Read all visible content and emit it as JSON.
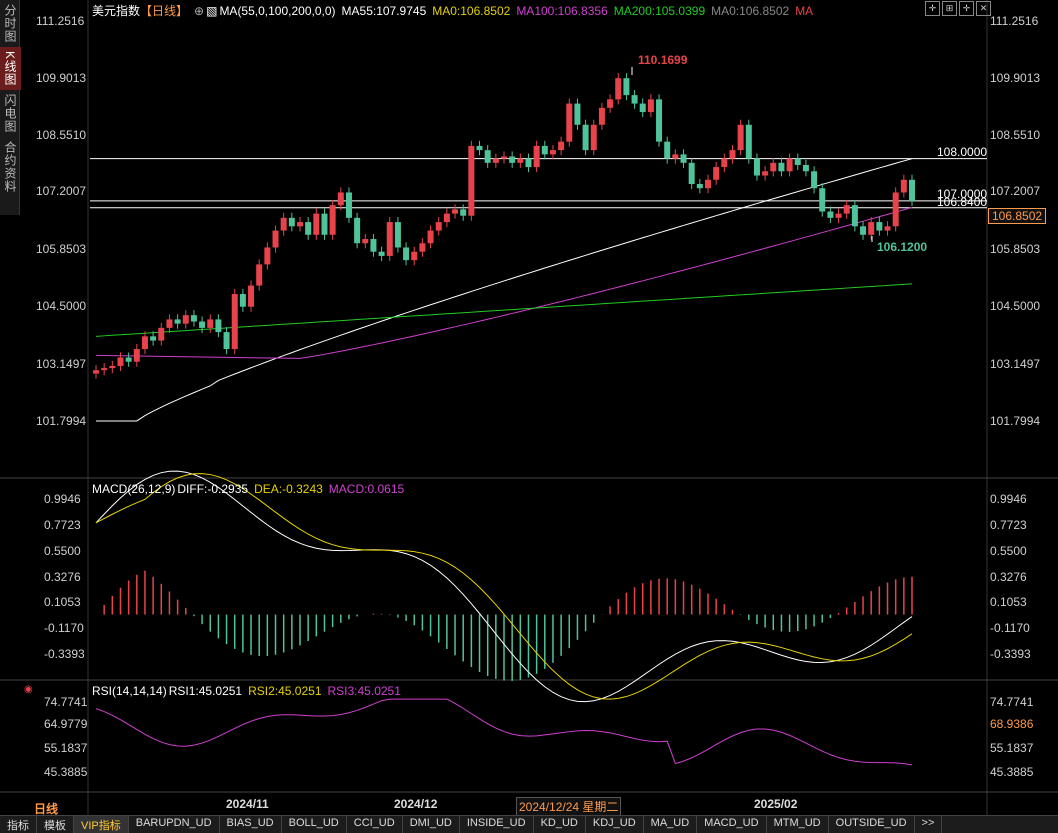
{
  "side_tabs": [
    "分时图",
    "K线图",
    "闪电图",
    "合约资料"
  ],
  "main_legend": {
    "title": "美元指数",
    "period": "【日线】",
    "plus": "⊕",
    "ma_params": "MA(55,0,100,200,0,0)",
    "ma55": "MA55:107.9745",
    "ma0a": "MA0:106.8502",
    "ma100": "MA100:106.8356",
    "ma200": "MA200:105.0399",
    "ma0b": "MA0:106.8502",
    "ma": "MA"
  },
  "price_axis_left": [
    "111.2516",
    "109.9013",
    "108.5510",
    "107.2007",
    "105.8503",
    "104.5000",
    "103.1497",
    "101.7994"
  ],
  "price_axis_right": [
    "111.2516",
    "109.9013",
    "108.5510",
    "107.2007",
    "105.8503",
    "104.5000",
    "103.1497",
    "101.7994"
  ],
  "current_price": "106.8502",
  "hlines": [
    {
      "label": "108.0000",
      "value": 108.0
    },
    {
      "label": "107.0000",
      "value": 107.0
    },
    {
      "label": "106.8400",
      "value": 106.84
    }
  ],
  "annotations": {
    "high": "110.1699",
    "low": "106.1200"
  },
  "macd_legend": {
    "params": "MACD(26,12,9)",
    "diff": "DIFF:-0.2935",
    "dea": "DEA:-0.3243",
    "macd": "MACD:0.0615"
  },
  "macd_axis": [
    "0.9946",
    "0.7723",
    "0.5500",
    "0.3276",
    "0.1053",
    "-0.1170",
    "-0.3393"
  ],
  "rsi_legend": {
    "params": "RSI(14,14,14)",
    "rsi1": "RSI1:45.0251",
    "rsi2": "RSI2:45.0251",
    "rsi3": "RSI3:45.0251"
  },
  "rsi_axis_left": [
    "74.7741",
    "64.9779",
    "55.1837",
    "45.3885"
  ],
  "rsi_axis_right": [
    "74.7741",
    "68.9386",
    "55.1837",
    "45.3885"
  ],
  "x_labels": [
    "2024/11",
    "2024/12",
    "2024/12/24 星期二",
    "2025/02"
  ],
  "period_label": "日线",
  "bottom_tabs": [
    "指标",
    "模板",
    "VIP指标",
    "BARUPDN_UD",
    "BIAS_UD",
    "BOLL_UD",
    "CCI_UD",
    "DMI_UD",
    "INSIDE_UD",
    "KD_UD",
    "KDJ_UD",
    "MA_UD",
    "MACD_UD",
    "MTM_UD",
    "OUTSIDE_UD",
    ">>"
  ],
  "colors": {
    "up": "#e8434b",
    "down": "#4fc39a",
    "ma55": "#ffffff",
    "ma100": "#d040d0",
    "ma200": "#22cc22",
    "dea": "#e6d200",
    "accent": "#ff9a4a"
  },
  "chart_data": {
    "type": "candlestick",
    "closes": [
      103.0,
      103.05,
      103.1,
      103.3,
      103.2,
      103.5,
      103.8,
      103.7,
      104.0,
      104.2,
      104.1,
      104.3,
      104.15,
      104.0,
      104.2,
      103.9,
      103.5,
      104.8,
      104.5,
      105.0,
      105.5,
      105.9,
      106.3,
      106.6,
      106.4,
      106.5,
      106.2,
      106.7,
      106.2,
      106.9,
      107.2,
      106.6,
      106.0,
      106.1,
      105.8,
      105.7,
      106.5,
      105.9,
      105.6,
      105.8,
      106.0,
      106.3,
      106.5,
      106.7,
      106.8,
      106.65,
      108.3,
      108.2,
      107.9,
      108.0,
      108.05,
      107.9,
      108.0,
      107.8,
      108.3,
      108.1,
      108.2,
      108.4,
      109.3,
      108.8,
      108.2,
      108.8,
      109.2,
      109.4,
      109.9,
      109.5,
      109.3,
      109.1,
      109.4,
      108.4,
      108.0,
      108.1,
      107.9,
      107.4,
      107.3,
      107.5,
      107.8,
      108.0,
      108.2,
      108.8,
      108.0,
      107.6,
      107.7,
      107.9,
      107.7,
      108.0,
      107.85,
      107.7,
      107.3,
      106.75,
      106.6,
      106.7,
      106.9,
      106.4,
      106.2,
      106.5,
      106.3,
      106.4,
      107.2,
      107.5,
      107.0
    ]
  }
}
